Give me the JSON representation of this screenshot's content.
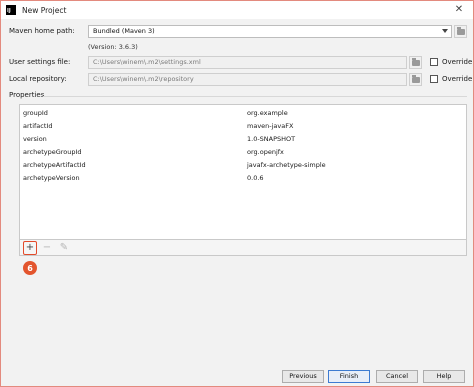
{
  "window": {
    "title": "New Project",
    "app_icon_text": "IJ"
  },
  "maven_home": {
    "label": "Maven home path:",
    "value": "Bundled (Maven 3)",
    "version_note": "(Version: 3.6.3)"
  },
  "user_settings": {
    "label": "User settings file:",
    "value": "C:\\Users\\winem\\.m2\\settings.xml",
    "override_label": "Override"
  },
  "local_repo": {
    "label": "Local repository:",
    "value": "C:\\Users\\winem\\.m2\\repository",
    "override_label": "Override"
  },
  "properties": {
    "section_label": "Properties",
    "rows": [
      {
        "key": "groupId",
        "value": "org.example"
      },
      {
        "key": "artifactId",
        "value": "maven-javaFX"
      },
      {
        "key": "version",
        "value": "1.0-SNAPSHOT"
      },
      {
        "key": "archetypeGroupId",
        "value": "org.openjfx"
      },
      {
        "key": "archetypeArtifactId",
        "value": "javafx-archetype-simple"
      },
      {
        "key": "archetypeVersion",
        "value": "0.0.6"
      }
    ]
  },
  "toolbar": {
    "add": "+",
    "remove": "−",
    "edit": "✎"
  },
  "callout": {
    "number": "6"
  },
  "footer": {
    "previous": "Previous",
    "finish": "Finish",
    "cancel": "Cancel",
    "help": "Help"
  },
  "colors": {
    "accent": "#e3552e",
    "primary_border": "#3d7bd1"
  }
}
